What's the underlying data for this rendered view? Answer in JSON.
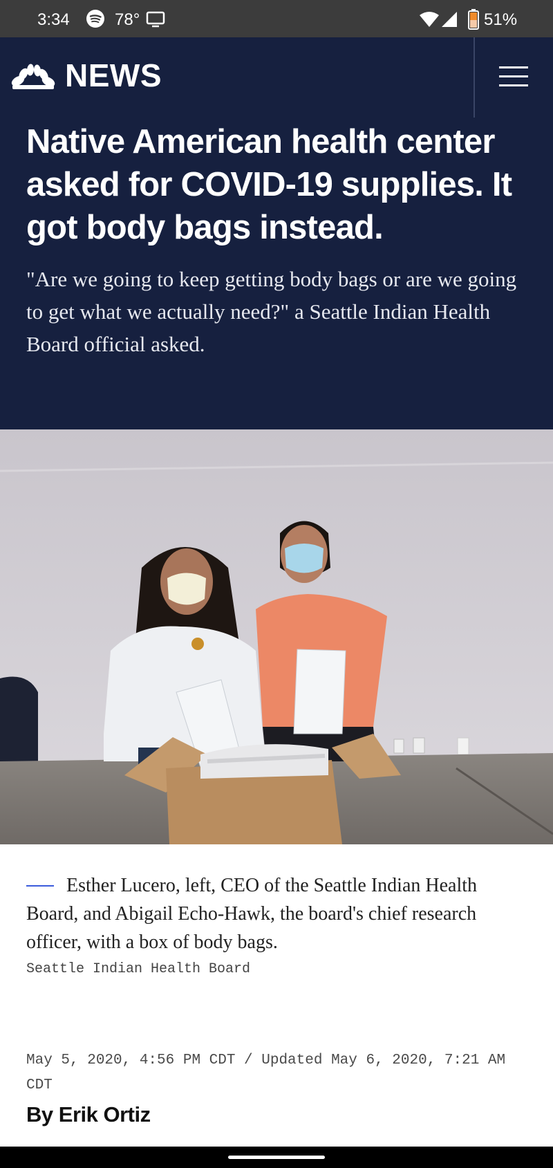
{
  "status_bar": {
    "time": "3:34",
    "temperature": "78°",
    "battery_percent": "51%",
    "icons": [
      "spotify-icon",
      "cast-icon",
      "wifi-icon",
      "signal-icon",
      "battery-icon"
    ]
  },
  "header": {
    "logo_text": "NEWS",
    "logo_icon": "peacock-icon",
    "menu_icon": "hamburger-menu-icon"
  },
  "article": {
    "headline": "Native American health center asked for COVID-19 supplies. It got body bags instead.",
    "dek": "\"Are we going to keep getting body bags or are we going to get what we actually need?\" a Seattle Indian Health Board official asked.",
    "caption": "Esther Lucero, left, CEO of the Seattle Indian Health Board, and Abigail Echo-Hawk, the board's chief research officer, with a box of body bags.",
    "photo_credit": "Seattle Indian Health Board",
    "dateline": "May 5, 2020, 4:56 PM CDT / Updated May 6, 2020, 7:21 AM CDT",
    "byline_prefix": "By",
    "author": "Erik Ortiz"
  },
  "colors": {
    "hero_background": "#16203f",
    "status_bar": "#3c3c3c",
    "caption_rule": "#3b5bdb"
  }
}
